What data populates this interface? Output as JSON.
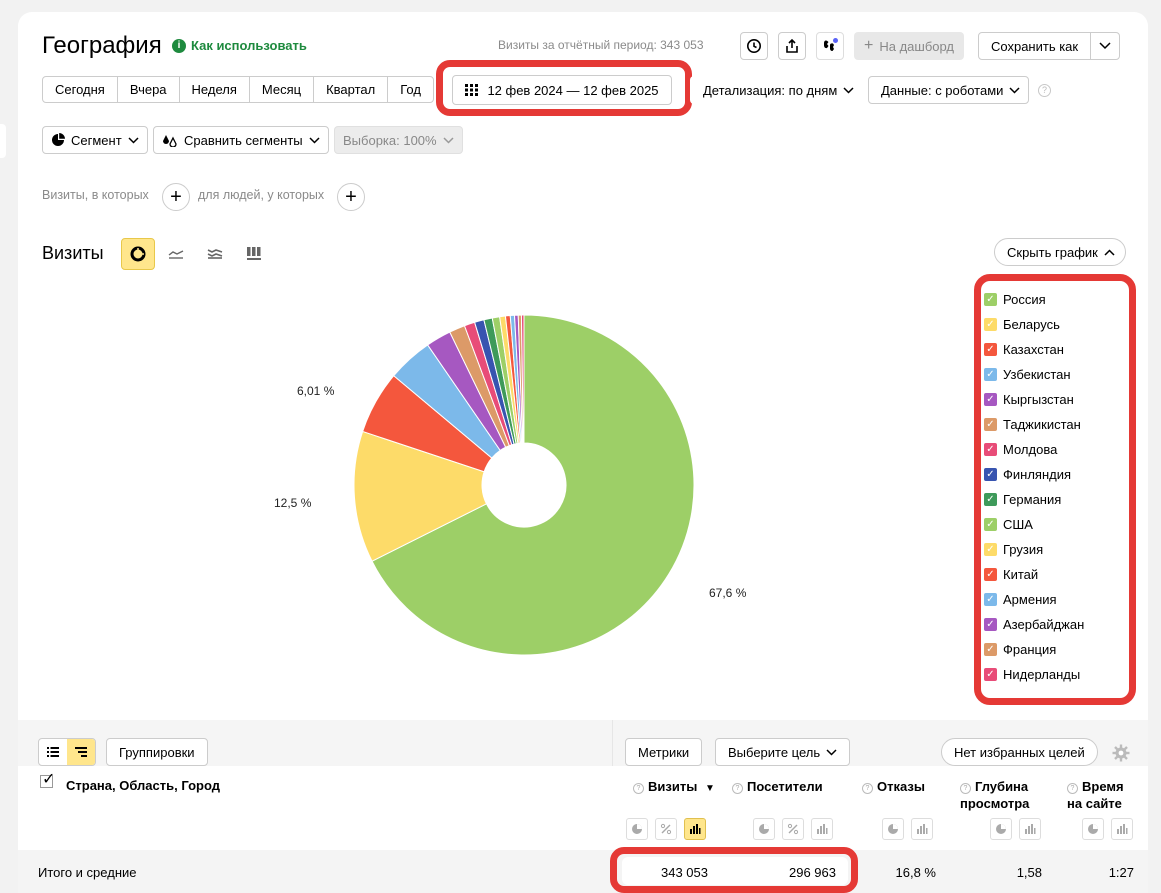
{
  "header": {
    "title": "География",
    "how_to_use": "Как использовать",
    "period_summary": "Визиты за отчётный период: 343 053",
    "dashboard_label": "На дашборд",
    "save_as_label": "Сохранить как"
  },
  "periods": [
    "Сегодня",
    "Вчера",
    "Неделя",
    "Месяц",
    "Квартал",
    "Год"
  ],
  "date_range": "12 фев 2024 — 12 фев 2025",
  "detail_label": "Детализация: по дням",
  "data_label": "Данные: с роботами",
  "segments": {
    "segment": "Сегмент",
    "compare": "Сравнить сегменты",
    "sample": "Выборка: 100%"
  },
  "conditions": {
    "visits_where": "Визиты, в которых",
    "people_where": "для людей, у которых"
  },
  "chart_section": {
    "title": "Визиты",
    "hide_label": "Скрыть график"
  },
  "chart_data": {
    "type": "pie",
    "donut": true,
    "labels": [
      "Россия",
      "Беларусь",
      "Казахстан",
      "Узбекистан",
      "Кыргызстан",
      "Таджикистан",
      "Молдова",
      "Финляндия",
      "Германия",
      "США",
      "Грузия",
      "Китай",
      "Армения",
      "Азербайджан",
      "Франция",
      "Нидерланды"
    ],
    "values": [
      67.6,
      12.5,
      6.01,
      4.3,
      2.4,
      1.5,
      1.0,
      0.9,
      0.8,
      0.7,
      0.55,
      0.45,
      0.4,
      0.35,
      0.3,
      0.24
    ],
    "colors": [
      "#9dcf67",
      "#fddb69",
      "#f4573d",
      "#7cb9ea",
      "#a658c1",
      "#dc9a68",
      "#e84c78",
      "#3854b0",
      "#3e9a5a",
      "#9dcf67",
      "#fddb69",
      "#f4573d",
      "#7cb9ea",
      "#a658c1",
      "#dc9a68",
      "#e84c78"
    ],
    "printed_percentages": [
      "67,6 %",
      "12,5 %",
      "6,01 %"
    ]
  },
  "table_toolbar": {
    "groupings": "Группировки",
    "metrics": "Метрики",
    "goal": "Выберите цель",
    "favorites": "Нет избранных целей"
  },
  "table": {
    "dimension_header": "Страна, Область, Город",
    "metrics": [
      {
        "name": "Визиты",
        "sorted": "▼"
      },
      {
        "name": "Посетители"
      },
      {
        "name": "Отказы"
      },
      {
        "name": "Глубина просмотра"
      },
      {
        "name": "Время на сайте"
      }
    ],
    "totals_label": "Итого и средние",
    "totals": [
      "343 053",
      "296 963",
      "16,8 %",
      "1,58",
      "1:27"
    ]
  }
}
